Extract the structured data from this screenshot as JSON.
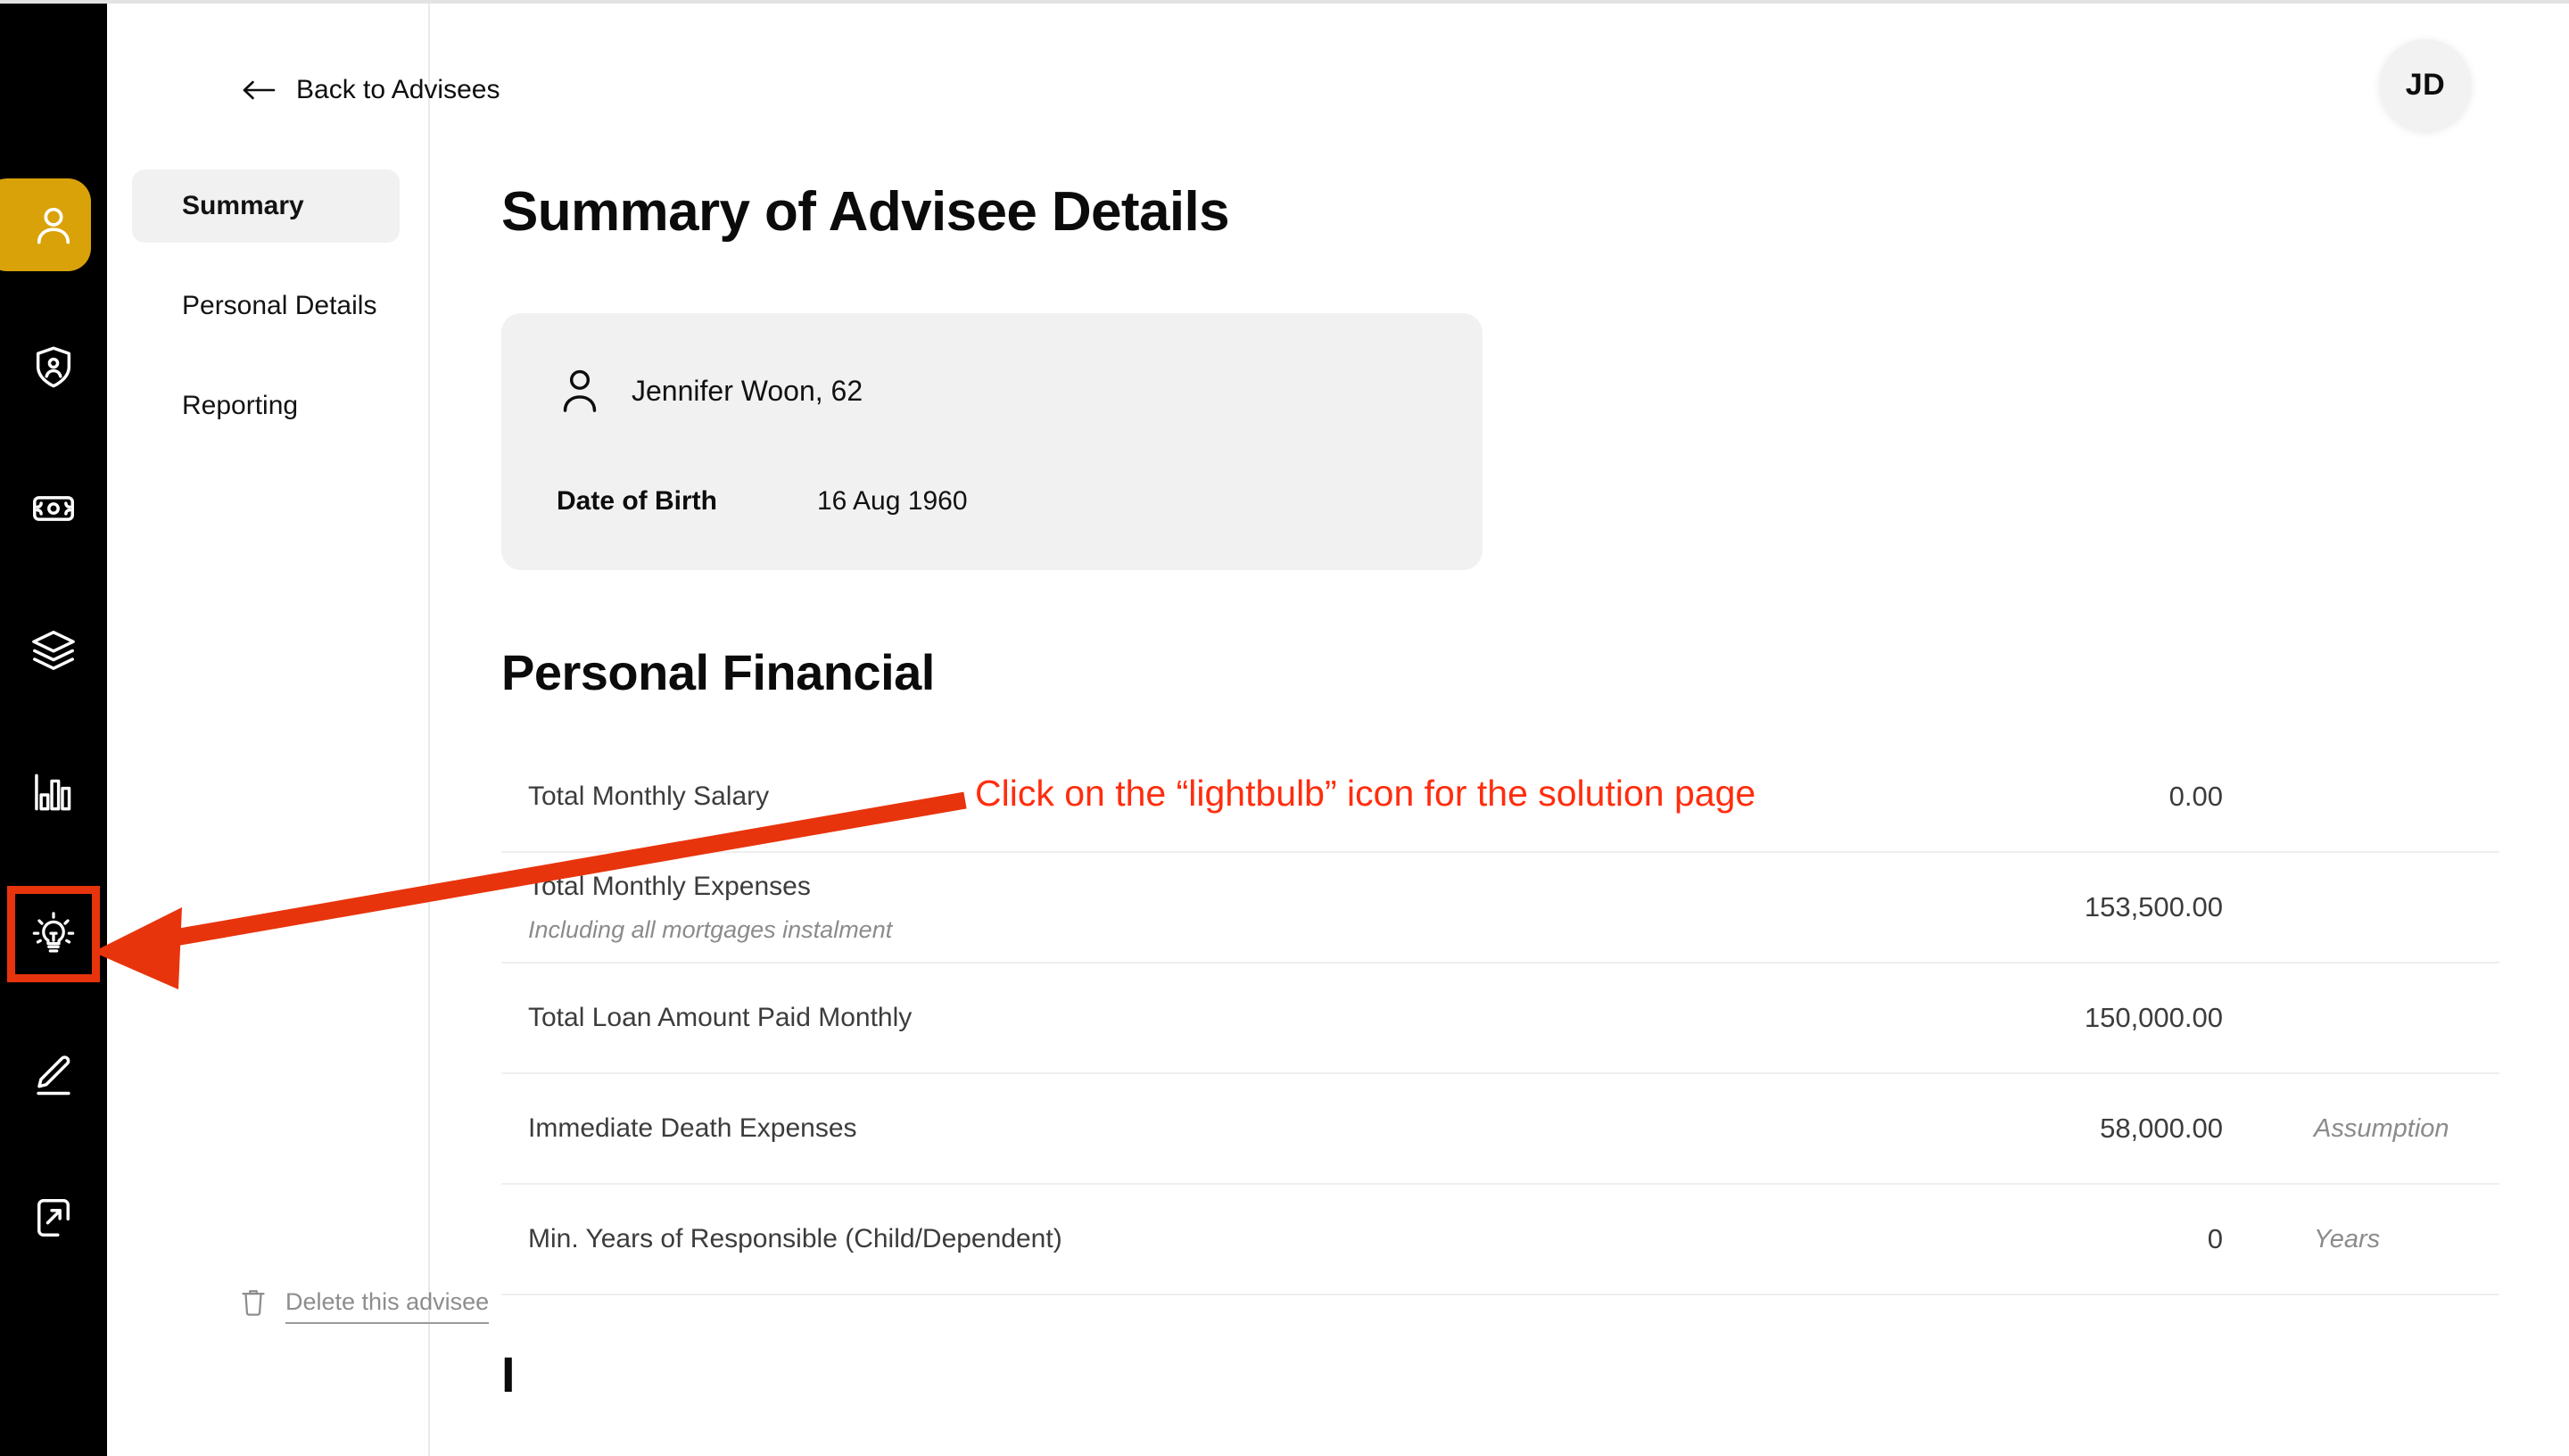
{
  "colors": {
    "rail_bg": "#000000",
    "accent_gold": "#d9a209",
    "annotation_red": "#ff2d0e",
    "highlight_box": "#e8340d",
    "card_bg": "#f1f1f1",
    "divider": "#efefef"
  },
  "rail": {
    "items": [
      {
        "id": "advisees",
        "icon": "user-icon",
        "active": true,
        "highlighted": false
      },
      {
        "id": "protection",
        "icon": "shield-user-icon",
        "active": false,
        "highlighted": false
      },
      {
        "id": "cashflow",
        "icon": "banknote-icon",
        "active": false,
        "highlighted": false
      },
      {
        "id": "portfolio",
        "icon": "layers-icon",
        "active": false,
        "highlighted": false
      },
      {
        "id": "analytics",
        "icon": "bar-chart-icon",
        "active": false,
        "highlighted": false
      },
      {
        "id": "solution",
        "icon": "lightbulb-icon",
        "active": false,
        "highlighted": true
      },
      {
        "id": "notes",
        "icon": "pencil-icon",
        "active": false,
        "highlighted": false
      },
      {
        "id": "logout",
        "icon": "logout-icon",
        "active": false,
        "highlighted": false
      }
    ]
  },
  "subnav": {
    "back_label": "Back to Advisees",
    "back_icon": "arrow-left-icon",
    "items": [
      {
        "label": "Summary",
        "active": true
      },
      {
        "label": "Personal Details",
        "active": false
      },
      {
        "label": "Reporting",
        "active": false
      }
    ],
    "delete": {
      "label": "Delete this advisee",
      "icon": "trash-icon"
    }
  },
  "header": {
    "avatar_initials": "JD"
  },
  "main": {
    "page_title": "Summary of Advisee Details",
    "advisee_card": {
      "person_icon": "user-icon",
      "name_and_age": "Jennifer Woon, 62",
      "dob_label": "Date of Birth",
      "dob_value": "16 Aug 1960"
    },
    "financial": {
      "section_title": "Personal Financial",
      "rows": [
        {
          "label": "Total Monthly Salary",
          "sub": "",
          "value": "0.00",
          "note": ""
        },
        {
          "label": "Total Monthly Expenses",
          "sub": "Including all mortgages instalment",
          "value": "153,500.00",
          "note": ""
        },
        {
          "label": "Total Loan Amount Paid Monthly",
          "sub": "",
          "value": "150,000.00",
          "note": ""
        },
        {
          "label": "Immediate Death Expenses",
          "sub": "",
          "value": "58,000.00",
          "note": "Assumption"
        },
        {
          "label": "Min. Years of Responsible (Child/Dependent)",
          "sub": "",
          "value": "0",
          "note": "Years"
        }
      ]
    },
    "next_section_peek": "I"
  },
  "annotation": {
    "text": "Click on the “lightbulb” icon for the solution page"
  }
}
